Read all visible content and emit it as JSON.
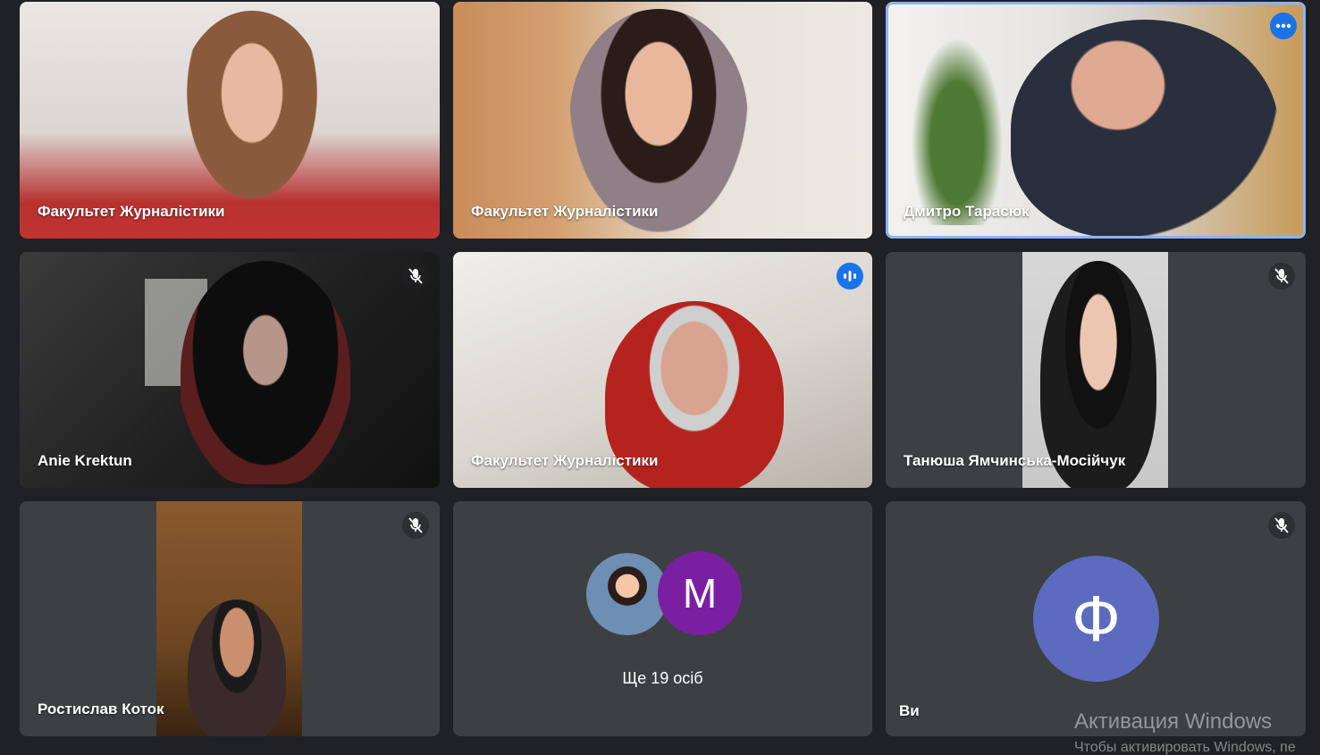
{
  "tiles": [
    {
      "name": "Факультет Журналістики"
    },
    {
      "name": "Факультет Журналістики"
    },
    {
      "name": "Дмитро Тарасюк"
    },
    {
      "name": "Anie Krektun"
    },
    {
      "name": "Факультет Журналістики"
    },
    {
      "name": "Танюша Ямчинська-Мосійчук"
    },
    {
      "name": "Ростислав Коток"
    },
    {
      "avatar_letter": "M",
      "more_count": "Ще 19 осіб"
    },
    {
      "avatar_letter": "Ф",
      "name": "Ви"
    }
  ],
  "watermark": {
    "title": "Активация Windows",
    "subtitle": "Чтобы активировать Windows, пе"
  },
  "colors": {
    "background": "#202124",
    "tile": "#3c4043",
    "accent_blue": "#1a73e8",
    "active_border": "#8ab4f8",
    "avatar_purple": "#7b1fa2",
    "avatar_indigo": "#5c6bc0"
  },
  "icons": [
    "mic-off-icon",
    "more-options-icon",
    "speaking-indicator-icon"
  ]
}
